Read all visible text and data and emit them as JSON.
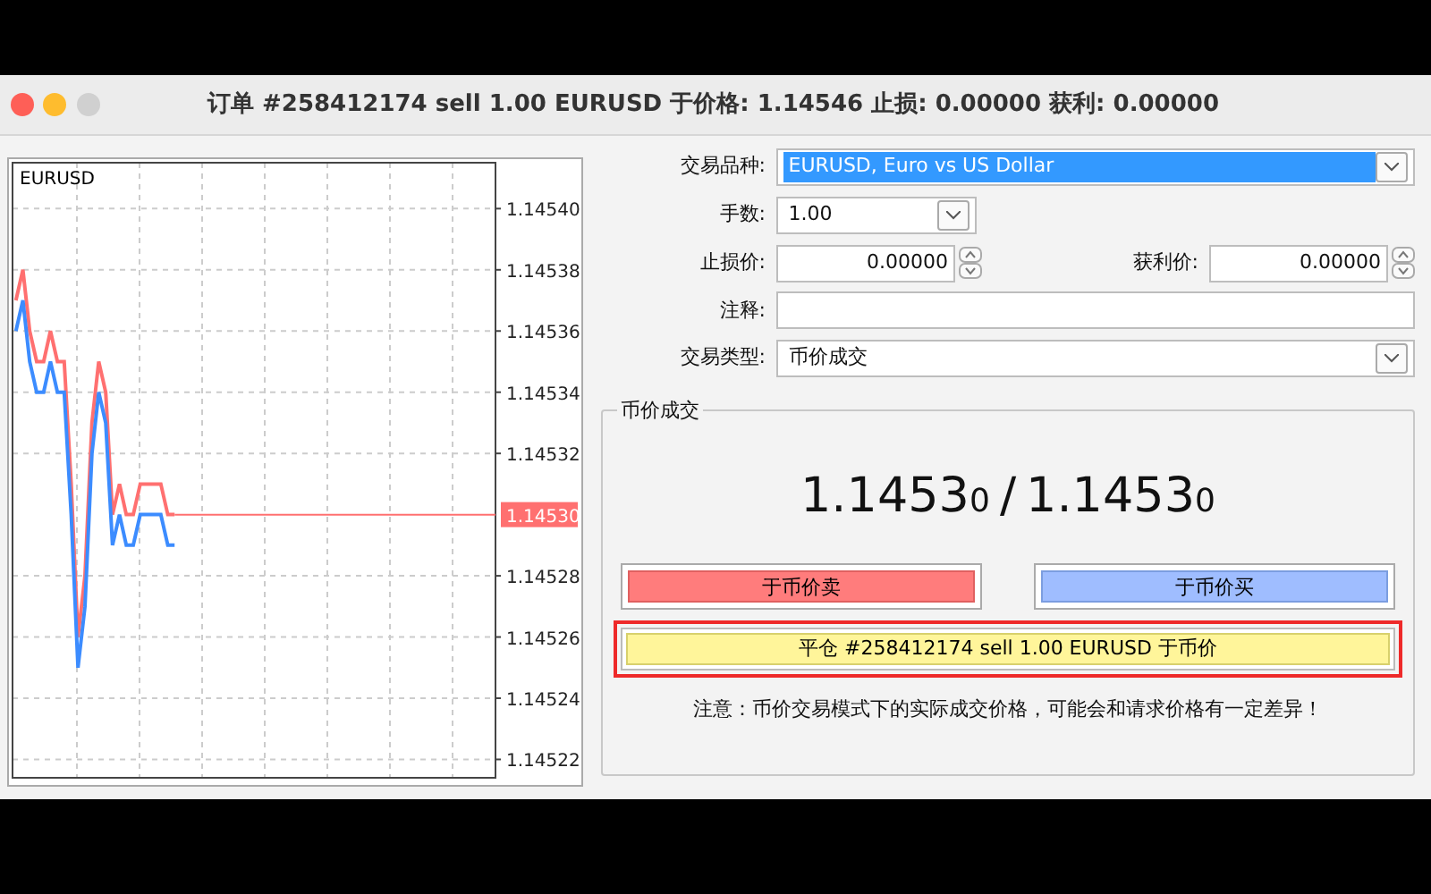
{
  "window": {
    "title": "订单 #258412174 sell 1.00 EURUSD 于价格: 1.14546 止损: 0.00000 获利: 0.00000"
  },
  "chart": {
    "chart_data": {
      "type": "line",
      "title": "EURUSD",
      "grid": true,
      "categories": [
        null,
        null,
        null,
        null,
        null,
        null,
        null,
        null,
        null,
        null,
        null,
        null,
        null,
        null,
        null,
        null,
        null,
        null,
        null,
        null,
        null,
        null,
        null,
        null,
        null,
        null,
        null,
        null,
        null,
        null,
        null,
        null,
        null,
        null,
        null,
        null,
        null,
        null,
        null,
        null,
        null,
        null,
        null,
        null,
        null,
        null,
        null,
        null,
        null,
        null,
        null,
        null,
        null,
        null,
        null,
        null,
        null,
        null,
        null,
        null,
        null,
        null,
        null,
        null,
        null,
        null,
        null,
        null,
        null,
        null
      ],
      "ylim": [
        1.145214,
        1.145415
      ],
      "yticks": [
        {
          "value": 1.1454,
          "label": "1.14540"
        },
        {
          "value": 1.14538,
          "label": "1.14538"
        },
        {
          "value": 1.14536,
          "label": "1.14536"
        },
        {
          "value": 1.14534,
          "label": "1.14534"
        },
        {
          "value": 1.14532,
          "label": "1.14532"
        },
        {
          "value": 1.14528,
          "label": "1.14528"
        },
        {
          "value": 1.14526,
          "label": "1.14526"
        },
        {
          "value": 1.14524,
          "label": "1.14524"
        },
        {
          "value": 1.14522,
          "label": "1.14522"
        }
      ],
      "series": [
        {
          "color": "#ff7070",
          "values": [
            1.14537,
            1.14538,
            1.14536,
            1.14535,
            1.14535,
            1.14536,
            1.14535,
            1.14535,
            1.14531,
            1.14526,
            1.14528,
            1.14533,
            1.14535,
            1.14534,
            1.1453,
            1.14531,
            1.1453,
            1.1453,
            1.14531,
            1.14531,
            1.14531,
            1.14531,
            1.1453,
            1.1453,
            null,
            null,
            null,
            null,
            null,
            null,
            null,
            null,
            null,
            null,
            null,
            null,
            null,
            null,
            null,
            null,
            null,
            null,
            null,
            null,
            null,
            null,
            null,
            null,
            null,
            null,
            null,
            null,
            null,
            null,
            null,
            null,
            null,
            null,
            null,
            null,
            null,
            null,
            null,
            null,
            null,
            null,
            null,
            null,
            null,
            null
          ]
        },
        {
          "color": "#3c8cff",
          "values": [
            1.14536,
            1.14537,
            1.14535,
            1.14534,
            1.14534,
            1.14535,
            1.14534,
            1.14534,
            1.1453,
            1.14525,
            1.14527,
            1.14532,
            1.14534,
            1.14533,
            1.14529,
            1.1453,
            1.14529,
            1.14529,
            1.1453,
            1.1453,
            1.1453,
            1.1453,
            1.14529,
            1.14529,
            null,
            null,
            null,
            null,
            null,
            null,
            null,
            null,
            null,
            null,
            null,
            null,
            null,
            null,
            null,
            null,
            null,
            null,
            null,
            null,
            null,
            null,
            null,
            null,
            null,
            null,
            null,
            null,
            null,
            null,
            null,
            null,
            null,
            null,
            null,
            null,
            null,
            null,
            null,
            null,
            null,
            null,
            null,
            null,
            null,
            null
          ]
        }
      ],
      "annotations": [
        "1.14530"
      ]
    }
  },
  "form": {
    "symbol": {
      "label": "交易品种:",
      "value": "EURUSD, Euro vs US Dollar",
      "highlighted": true
    },
    "volume": {
      "label": "手数:",
      "value": "1.00"
    },
    "stop_loss": {
      "label": "止损价:",
      "value": "0.00000"
    },
    "take_profit": {
      "label": "获利价:",
      "value": "0.00000"
    },
    "comment": {
      "label": "注释:"
    },
    "order_type": {
      "label": "交易类型:",
      "value": "币价成交"
    }
  },
  "market": {
    "title": "币价成交",
    "bid": {
      "main": "1.1453",
      "small": "0"
    },
    "separator": "/",
    "ask": {
      "main": "1.1453",
      "small": "0"
    },
    "sell_button": "于币价卖",
    "buy_button": "于币价买",
    "close_button": {
      "label": "平仓 #258412174 sell 1.00 EURUSD 于币价",
      "highlighted": true
    },
    "note": "注意：币价交易模式下的实际成交价格，可能会和请求价格有一定差异！"
  }
}
